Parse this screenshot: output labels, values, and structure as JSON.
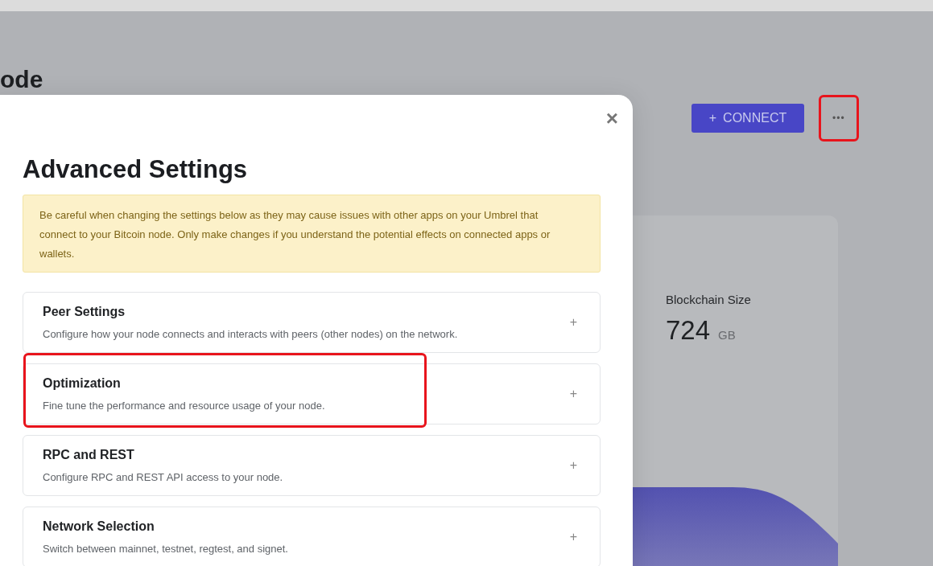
{
  "page": {
    "title_fragment": "ode",
    "connect_button": {
      "icon": "+",
      "label": "CONNECT"
    },
    "more_button": {
      "label": "•••",
      "highlighted": true
    },
    "stat_card": {
      "label": "Blockchain Size",
      "value": "724",
      "unit": "GB"
    }
  },
  "modal": {
    "close": "×",
    "title": "Advanced Settings",
    "warning": "Be careful when changing the settings below as they may cause issues with other apps on your Umbrel that connect to your Bitcoin node. Only make changes if you understand the potential effects on connected apps or wallets.",
    "sections": [
      {
        "title": "Peer Settings",
        "description": "Configure how your node connects and interacts with peers (other nodes) on the network.",
        "expanded": false,
        "highlighted": false
      },
      {
        "title": "Optimization",
        "description": "Fine tune the performance and resource usage of your node.",
        "expanded": false,
        "highlighted": true
      },
      {
        "title": "RPC and REST",
        "description": "Configure RPC and REST API access to your node.",
        "expanded": false,
        "highlighted": false
      },
      {
        "title": "Network Selection",
        "description": "Switch between mainnet, testnet, regtest, and signet.",
        "expanded": false,
        "highlighted": false
      }
    ]
  }
}
